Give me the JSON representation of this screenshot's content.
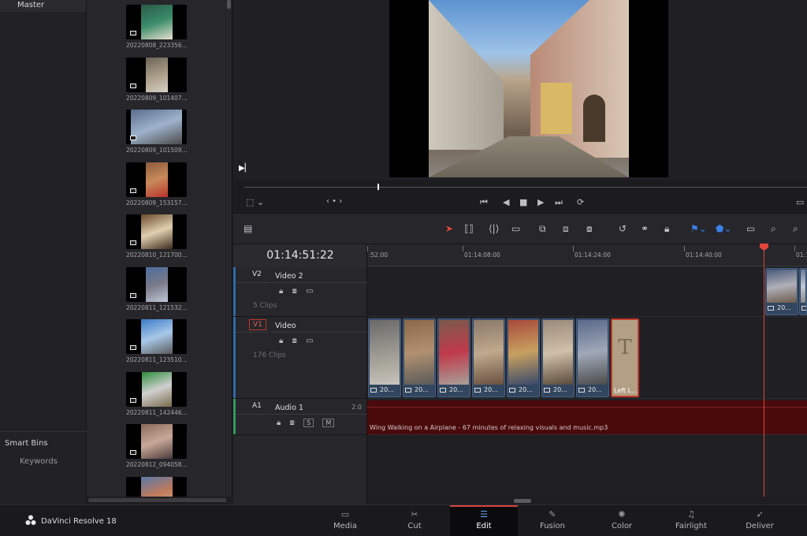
{
  "bins": {
    "master": "Master",
    "smart_bins": "Smart Bins",
    "keywords": "Keywords"
  },
  "media_pool": {
    "clips": [
      {
        "name": "20220808_223356...",
        "colors": [
          "#2a5a48",
          "#3b8c6a",
          "#e8e0d0"
        ]
      },
      {
        "name": "20220809_101407...",
        "colors": [
          "#6b6356",
          "#a99c86",
          "#d7d1c4"
        ]
      },
      {
        "name": "20220809_101509...",
        "colors": [
          "#5a6c8c",
          "#9fb3cc",
          "#4a4a4a"
        ]
      },
      {
        "name": "20220809_153157...",
        "colors": [
          "#8a5a3c",
          "#c98a5a",
          "#b8342c"
        ]
      },
      {
        "name": "20220810_121700...",
        "colors": [
          "#6a4a2c",
          "#e0d0b0",
          "#3c2a1c"
        ]
      },
      {
        "name": "20220811_121532...",
        "colors": [
          "#4a6c9c",
          "#7a7a8a",
          "#c0c8d8"
        ]
      },
      {
        "name": "20220811_123510...",
        "colors": [
          "#3a7ac8",
          "#a8c8e8",
          "#5a5a5a"
        ]
      },
      {
        "name": "20220811_142446...",
        "colors": [
          "#2c8c3c",
          "#d0d0d0",
          "#7a6a4a"
        ]
      },
      {
        "name": "20220812_094058...",
        "colors": [
          "#8a6a5a",
          "#c8a898",
          "#4a3a3a"
        ]
      },
      {
        "name": "",
        "colors": [
          "#5a7aa8",
          "#c07a5a",
          "#d0c0a0"
        ]
      }
    ]
  },
  "viewer": {
    "play_icon": "play-pause-icon"
  },
  "transport": {
    "crop_icon": "crop-icon",
    "jog": "‹ • ›",
    "skip_start": "⏮",
    "prev": "◀",
    "stop": "■",
    "play": "▶",
    "skip_end": "⏭",
    "loop": "⟳"
  },
  "timeline": {
    "timecode": "01:14:51:22",
    "ruler_labels": [
      ":52:00",
      "01:14:08:00",
      "01:14:24:00",
      "01:14:40:00",
      "01:1"
    ],
    "tracks": {
      "v2": {
        "id": "V2",
        "name": "Video 2",
        "count": "5 Clips"
      },
      "v1": {
        "id": "V1",
        "name": "Video",
        "count": "176 Clips"
      },
      "a1": {
        "id": "A1",
        "name": "Audio 1",
        "volume": "2.0",
        "solo": "S",
        "mute": "M"
      }
    },
    "v1_clips": [
      {
        "label": "20...",
        "colors": [
          "#6a6a6a",
          "#9a9890",
          "#c8c4bc"
        ]
      },
      {
        "label": "20...",
        "colors": [
          "#8a6a4a",
          "#b09070",
          "#5a5a5a"
        ]
      },
      {
        "label": "20...",
        "colors": [
          "#7a5a4a",
          "#c03a4a",
          "#a8a098"
        ]
      },
      {
        "label": "20...",
        "colors": [
          "#8a7a6a",
          "#c0a88c",
          "#6a5040"
        ]
      },
      {
        "label": "20...",
        "colors": [
          "#a84a3a",
          "#c8a060",
          "#3a4a6a"
        ]
      },
      {
        "label": "20...",
        "colors": [
          "#9a8a7a",
          "#d0c0a8",
          "#5a4a3a"
        ]
      },
      {
        "label": "20...",
        "colors": [
          "#5a6a8a",
          "#a0a8b8",
          "#4a4a4a"
        ]
      }
    ],
    "title_clip": {
      "glyph": "T",
      "label": "Left L..."
    },
    "v2_clips": [
      {
        "label": "20...",
        "colors": [
          "#4a5a7a",
          "#b0b0b8",
          "#6a5a4a"
        ]
      },
      {
        "label": "",
        "colors": [
          "#6a7a9a",
          "#c0c8d8",
          "#8a8a8a"
        ]
      }
    ],
    "audio_clip": {
      "label": "Wing Walking on a Airplane - 67 minutes of relaxing visuals and music.mp3"
    }
  },
  "page_bar": {
    "brand": "DaVinci Resolve 18",
    "pages": [
      {
        "label": "Media",
        "icon": "▭",
        "icon_name": "media-page-icon",
        "active": false
      },
      {
        "label": "Cut",
        "icon": "✂",
        "icon_name": "cut-page-icon",
        "active": false
      },
      {
        "label": "Edit",
        "icon": "☰",
        "icon_name": "edit-page-icon",
        "active": true
      },
      {
        "label": "Fusion",
        "icon": "✎",
        "icon_name": "fusion-page-icon",
        "active": false
      },
      {
        "label": "Color",
        "icon": "✺",
        "icon_name": "color-page-icon",
        "active": false
      },
      {
        "label": "Fairlight",
        "icon": "♫",
        "icon_name": "fairlight-page-icon",
        "active": false
      },
      {
        "label": "Deliver",
        "icon": "➶",
        "icon_name": "deliver-page-icon",
        "active": false
      }
    ]
  },
  "colors": {
    "accent": "#d7443a",
    "clip_blue": "#32465f",
    "audio_red": "#4a0a0c",
    "title_clip": "#b39f83"
  }
}
